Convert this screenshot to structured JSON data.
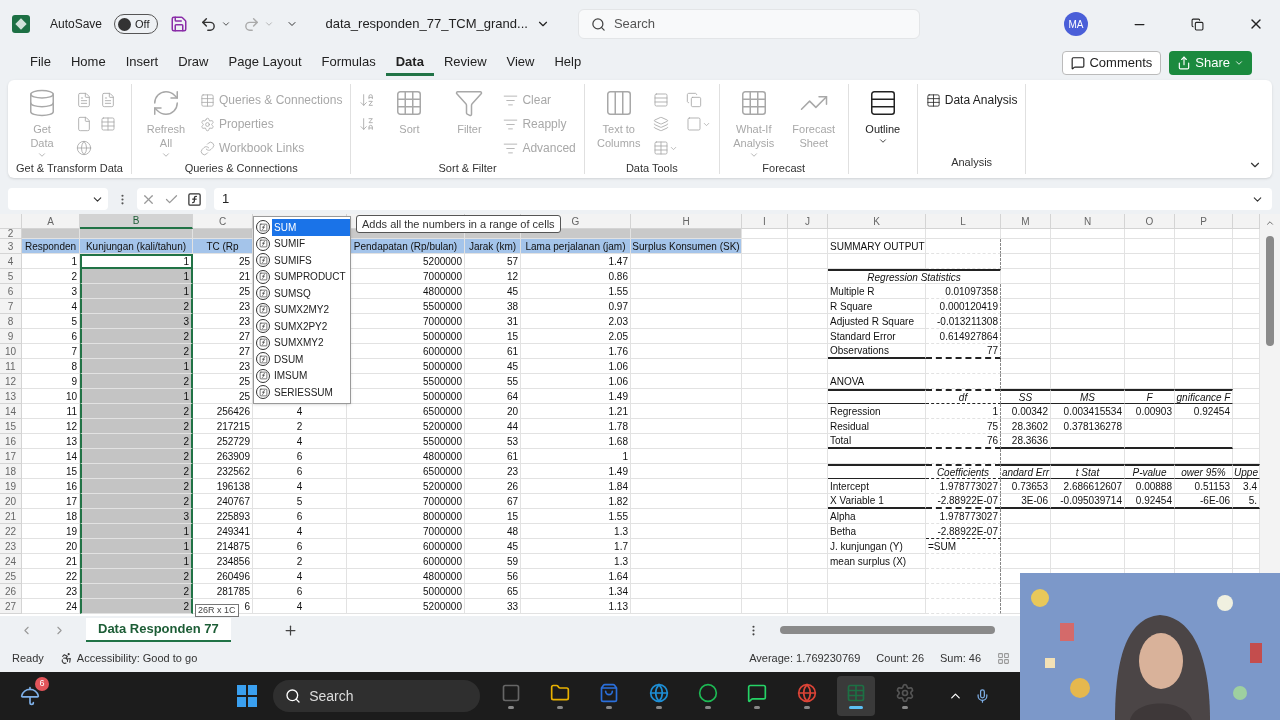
{
  "titlebar": {
    "autosave_label": "AutoSave",
    "autosave": {
      "on": false,
      "label": "Off"
    },
    "filename": "data_responden_77_TCM_grand...",
    "search_placeholder": "Search",
    "avatar": "MA"
  },
  "menu_tabs": [
    {
      "label": "File",
      "selected": false
    },
    {
      "label": "Home",
      "selected": false
    },
    {
      "label": "Insert",
      "selected": false
    },
    {
      "label": "Draw",
      "selected": false
    },
    {
      "label": "Page Layout",
      "selected": false
    },
    {
      "label": "Formulas",
      "selected": false
    },
    {
      "label": "Data",
      "selected": true
    },
    {
      "label": "Review",
      "selected": false
    },
    {
      "label": "View",
      "selected": false
    },
    {
      "label": "Help",
      "selected": false
    }
  ],
  "comments_button": "Comments",
  "share_button": "Share",
  "ribbon_groups": [
    {
      "label": "Get & Transform Data",
      "items": [
        {
          "kind": "large_menu",
          "label": "Get Data",
          "disabled": true
        },
        {
          "kind": "icon",
          "disabled": true
        },
        {
          "kind": "icon",
          "disabled": true
        },
        {
          "kind": "icon",
          "disabled": true
        },
        {
          "kind": "icon",
          "disabled": true
        },
        {
          "kind": "icon",
          "disabled": true
        }
      ]
    },
    {
      "label": "Queries & Connections",
      "items": [
        {
          "kind": "large_menu",
          "label": "Refresh All",
          "disabled": true
        },
        {
          "kind": "small",
          "label": "Queries & Connections",
          "disabled": true
        },
        {
          "kind": "small",
          "label": "Properties",
          "disabled": true
        },
        {
          "kind": "small",
          "label": "Workbook Links",
          "disabled": true
        }
      ]
    },
    {
      "label": "Sort & Filter",
      "items": [
        {
          "kind": "icon",
          "disabled": true
        },
        {
          "kind": "icon",
          "disabled": true
        },
        {
          "kind": "large",
          "label": "Sort",
          "disabled": true
        },
        {
          "kind": "large",
          "label": "Filter",
          "disabled": true
        },
        {
          "kind": "small",
          "label": "Clear",
          "disabled": true
        },
        {
          "kind": "small",
          "label": "Reapply",
          "disabled": true
        },
        {
          "kind": "small",
          "label": "Advanced",
          "disabled": true
        }
      ]
    },
    {
      "label": "Data Tools",
      "items": [
        {
          "kind": "large",
          "label": "Text to Columns",
          "disabled": true
        },
        {
          "kind": "icon",
          "disabled": true
        },
        {
          "kind": "icon",
          "disabled": true
        },
        {
          "kind": "icon_menu",
          "disabled": true
        },
        {
          "kind": "icon",
          "disabled": true
        },
        {
          "kind": "icon_menu",
          "disabled": true
        }
      ]
    },
    {
      "label": "Forecast",
      "items": [
        {
          "kind": "large_menu",
          "label": "What-If Analysis",
          "disabled": true
        },
        {
          "kind": "large",
          "label": "Forecast Sheet",
          "disabled": true
        }
      ]
    },
    {
      "items": [
        {
          "kind": "large_menu",
          "label": "Outline",
          "disabled": false
        }
      ]
    },
    {
      "label": "Analysis",
      "items": [
        {
          "kind": "small",
          "label": "Data Analysis",
          "disabled": false
        }
      ]
    }
  ],
  "formula_bar": {
    "value": "1"
  },
  "column_headers": {
    "A": {
      "label": "A",
      "selected": false
    },
    "B": {
      "label": "B",
      "selected": true
    },
    "C": {
      "label": "C",
      "selected": false
    },
    "G": {
      "label": "G",
      "selected": false
    },
    "H": {
      "label": "H",
      "selected": false
    },
    "I": {
      "label": "I",
      "selected": false
    },
    "J": {
      "label": "J",
      "selected": false
    },
    "K": {
      "label": "K",
      "selected": false
    },
    "L": {
      "label": "L",
      "selected": false
    },
    "M": {
      "label": "M",
      "selected": false
    },
    "N": {
      "label": "N",
      "selected": false
    },
    "O": {
      "label": "O",
      "selected": false
    },
    "P": {
      "label": "P",
      "selected": false
    }
  },
  "header_rows": [
    {
      "num": "2",
      "kind": "band",
      "cells": {}
    },
    {
      "num": "3",
      "kind": "header",
      "cells": {
        "A": "Responden",
        "B": "Kunjungan (kali/tahun)",
        "C": "TC (Rp",
        "E": "Pendapatan (Rp/bulan)",
        "F": "Jarak (km)",
        "G": "Lama perjalanan (jam)",
        "H": "Surplus Konsumen (SK)",
        "K": "SUMMARY OUTPUT"
      }
    }
  ],
  "rows": [
    {
      "num": "4",
      "kind": "data",
      "active": true,
      "cells": {
        "A": "1",
        "B": "1",
        "C": "25",
        "E": "5200000",
        "F": "57",
        "G": "1.47"
      }
    },
    {
      "num": "5",
      "kind": "data",
      "active": false,
      "cells": {
        "A": "2",
        "B": "1",
        "C": "21",
        "E": "7000000",
        "F": "12",
        "G": "0.86",
        "K": "Regression Statistics"
      }
    },
    {
      "num": "6",
      "kind": "data",
      "active": false,
      "cells": {
        "A": "3",
        "B": "1",
        "C": "25",
        "E": "4800000",
        "F": "45",
        "G": "1.55",
        "K": "Multiple R",
        "L": "0.01097358"
      }
    },
    {
      "num": "7",
      "kind": "data",
      "active": false,
      "cells": {
        "A": "4",
        "B": "2",
        "C": "23",
        "E": "5500000",
        "F": "38",
        "G": "0.97",
        "K": "R Square",
        "L": "0.000120419"
      }
    },
    {
      "num": "8",
      "kind": "data",
      "active": false,
      "cells": {
        "A": "5",
        "B": "3",
        "C": "23",
        "E": "7000000",
        "F": "31",
        "G": "2.03",
        "K": "Adjusted R Square",
        "L": "-0.013211308"
      }
    },
    {
      "num": "9",
      "kind": "data",
      "active": false,
      "cells": {
        "A": "6",
        "B": "2",
        "C": "27",
        "E": "5000000",
        "F": "15",
        "G": "2.05",
        "K": "Standard Error",
        "L": "0.614927864"
      }
    },
    {
      "num": "10",
      "kind": "data",
      "active": false,
      "cells": {
        "A": "7",
        "B": "2",
        "C": "27",
        "E": "6000000",
        "F": "61",
        "G": "1.76",
        "K": "Observations",
        "L": "77"
      }
    },
    {
      "num": "11",
      "kind": "data",
      "active": false,
      "cells": {
        "A": "8",
        "B": "1",
        "C": "23",
        "E": "5000000",
        "F": "45",
        "G": "1.06"
      }
    },
    {
      "num": "12",
      "kind": "data",
      "active": false,
      "cells": {
        "A": "9",
        "B": "2",
        "C": "25",
        "E": "5500000",
        "F": "55",
        "G": "1.06",
        "K": "ANOVA"
      }
    },
    {
      "num": "13",
      "kind": "data",
      "active": false,
      "cells": {
        "A": "10",
        "B": "1",
        "C": "25",
        "E": "5000000",
        "F": "64",
        "G": "1.49",
        "L": "df",
        "M": "SS",
        "N": "MS",
        "O": "F",
        "P": "gnificance F"
      }
    },
    {
      "num": "14",
      "kind": "data",
      "active": false,
      "cells": {
        "A": "11",
        "B": "2",
        "C": "256426",
        "D": "4",
        "E": "6500000",
        "F": "20",
        "G": "1.21",
        "K": "Regression",
        "L": "1",
        "M": "0.00342",
        "N": "0.003415534",
        "O": "0.00903",
        "P": "0.92454"
      }
    },
    {
      "num": "15",
      "kind": "data",
      "active": false,
      "cells": {
        "A": "12",
        "B": "2",
        "C": "217215",
        "D": "2",
        "E": "5200000",
        "F": "44",
        "G": "1.78",
        "K": "Residual",
        "L": "75",
        "M": "28.3602",
        "N": "0.378136278"
      }
    },
    {
      "num": "16",
      "kind": "data",
      "active": false,
      "cells": {
        "A": "13",
        "B": "2",
        "C": "252729",
        "D": "4",
        "E": "5500000",
        "F": "53",
        "G": "1.68",
        "K": "Total",
        "L": "76",
        "M": "28.3636"
      }
    },
    {
      "num": "17",
      "kind": "data",
      "active": false,
      "cells": {
        "A": "14",
        "B": "2",
        "C": "263909",
        "D": "6",
        "E": "4800000",
        "F": "61",
        "G": "1"
      }
    },
    {
      "num": "18",
      "kind": "data",
      "active": false,
      "cells": {
        "A": "15",
        "B": "2",
        "C": "232562",
        "D": "6",
        "E": "6500000",
        "F": "23",
        "G": "1.49",
        "L": "Coefficients",
        "M": "andard Err",
        "N": "t Stat",
        "O": "P-value",
        "P": "ower 95%",
        "Q": "Uppe"
      }
    },
    {
      "num": "19",
      "kind": "data",
      "active": false,
      "cells": {
        "A": "16",
        "B": "2",
        "C": "196138",
        "D": "4",
        "E": "5200000",
        "F": "26",
        "G": "1.84",
        "K": "Intercept",
        "L": "1.978773027",
        "M": "0.73653",
        "N": "2.686612607",
        "O": "0.00888",
        "P": "0.51153",
        "Q": "3.4"
      }
    },
    {
      "num": "20",
      "kind": "data",
      "active": false,
      "cells": {
        "A": "17",
        "B": "2",
        "C": "240767",
        "D": "5",
        "E": "7000000",
        "F": "67",
        "G": "1.82",
        "K": "X Variable 1",
        "L": "-2.88922E-07",
        "M": "3E-06",
        "N": "-0.095039714",
        "O": "0.92454",
        "P": "-6E-06",
        "Q": "5."
      }
    },
    {
      "num": "21",
      "kind": "data",
      "active": false,
      "cells": {
        "A": "18",
        "B": "3",
        "C": "225893",
        "D": "6",
        "E": "8000000",
        "F": "15",
        "G": "1.55",
        "K": "Alpha",
        "L": "1.978773027"
      }
    },
    {
      "num": "22",
      "kind": "data",
      "active": false,
      "cells": {
        "A": "19",
        "B": "1",
        "C": "249341",
        "D": "4",
        "E": "7000000",
        "F": "48",
        "G": "1.3",
        "K": "Betha",
        "L": "-2.88922E-07"
      }
    },
    {
      "num": "23",
      "kind": "data",
      "active": false,
      "cells": {
        "A": "20",
        "B": "1",
        "C": "214875",
        "D": "6",
        "E": "6000000",
        "F": "45",
        "G": "1.7",
        "K": "J. kunjungan (Y)",
        "L": {
          "kind": "formula",
          "text": "=SUM"
        }
      }
    },
    {
      "num": "24",
      "kind": "data",
      "active": false,
      "cells": {
        "A": "21",
        "B": "1",
        "C": "234856",
        "D": "2",
        "E": "6000000",
        "F": "59",
        "G": "1.3",
        "K": "mean surplus (X)"
      }
    },
    {
      "num": "25",
      "kind": "data",
      "active": false,
      "cells": {
        "A": "22",
        "B": "2",
        "C": "260496",
        "D": "4",
        "E": "4800000",
        "F": "56",
        "G": "1.64"
      }
    },
    {
      "num": "26",
      "kind": "data",
      "active": false,
      "cells": {
        "A": "23",
        "B": "2",
        "C": "281785",
        "D": "6",
        "E": "5000000",
        "F": "65",
        "G": "1.34"
      }
    },
    {
      "num": "27",
      "kind": "data",
      "active": false,
      "cells": {
        "A": "24",
        "B": "2",
        "C": "6",
        "D": "4",
        "E": "5200000",
        "F": "33",
        "G": "1.13"
      }
    }
  ],
  "autocomplete": {
    "items": [
      {
        "label": "SUM",
        "selected": true
      },
      {
        "label": "SUMIF",
        "selected": false
      },
      {
        "label": "SUMIFS",
        "selected": false
      },
      {
        "label": "SUMPRODUCT",
        "selected": false
      },
      {
        "label": "SUMSQ",
        "selected": false
      },
      {
        "label": "SUMX2MY2",
        "selected": false
      },
      {
        "label": "SUMX2PY2",
        "selected": false
      },
      {
        "label": "SUMXMY2",
        "selected": false
      },
      {
        "label": "DSUM",
        "selected": false
      },
      {
        "label": "IMSUM",
        "selected": false
      },
      {
        "label": "SERIESSUM",
        "selected": false
      }
    ],
    "tooltip": "Adds all the numbers in a range of cells"
  },
  "selection_size": "26R x 1C",
  "sheet_tabs": [
    {
      "label": "Data Responden 77",
      "selected": true
    }
  ],
  "status_bar": {
    "mode": "Ready",
    "accessibility": "Accessibility: Good to go",
    "average": "Average: 1.769230769",
    "count": "Count: 26",
    "sum": "Sum: 46"
  },
  "taskbar": {
    "weather_badge": "6",
    "search_placeholder": "Search",
    "apps": [
      {
        "selected": false
      },
      {
        "selected": false
      },
      {
        "selected": false
      },
      {
        "selected": false
      },
      {
        "selected": false
      },
      {
        "selected": false
      },
      {
        "selected": false
      },
      {
        "selected": true
      },
      {
        "selected": false
      }
    ]
  }
}
